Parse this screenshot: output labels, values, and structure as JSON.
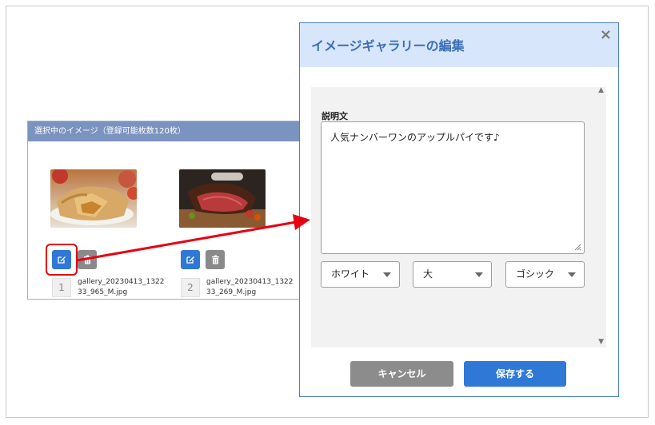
{
  "gallery": {
    "header": "選択中のイメージ（登録可能枚数120枚）",
    "items": [
      {
        "number": "1",
        "filename": "gallery_20230413_132233_965_M.jpg",
        "image": "apple-pie-photo"
      },
      {
        "number": "2",
        "filename": "gallery_20230413_132233_269_M.jpg",
        "image": "roast-beef-photo"
      }
    ]
  },
  "modal": {
    "title": "イメージギャラリーの編集",
    "close": "×",
    "description_label": "説明文",
    "description_value": "人気ナンバーワンのアップルパイです♪",
    "selects": {
      "color": "ホワイト",
      "size": "大",
      "font": "ゴシック"
    },
    "cancel_label": "キャンセル",
    "save_label": "保存する"
  },
  "colors": {
    "accent": "#2f78d6",
    "header_bg": "#d7e6fb",
    "gallery_header_bg": "#7b93bf",
    "highlight": "#e60012"
  }
}
